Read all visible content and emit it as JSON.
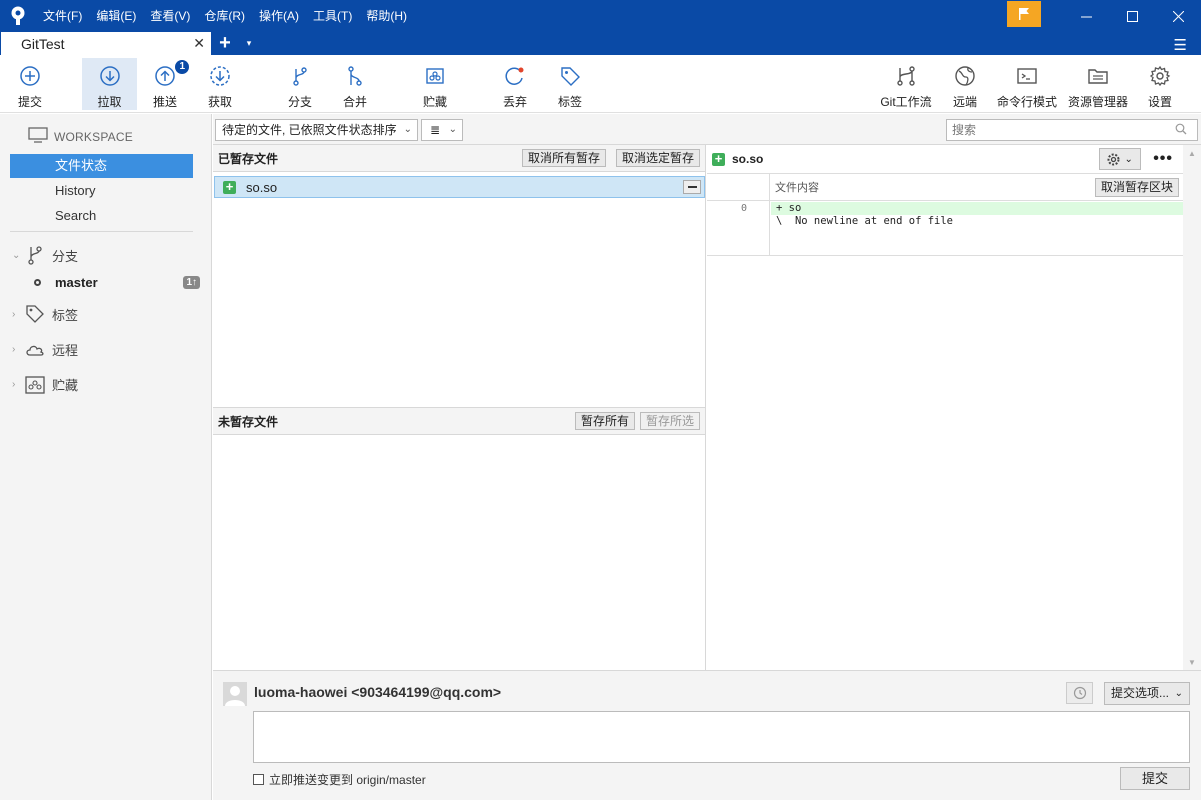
{
  "menu": [
    "文件(F)",
    "编辑(E)",
    "查看(V)",
    "仓库(R)",
    "操作(A)",
    "工具(T)",
    "帮助(H)"
  ],
  "tab": {
    "title": "GitTest",
    "close": "✕",
    "add": "+",
    "dropdown": "▾"
  },
  "toolbar": {
    "commit": "提交",
    "pull": "拉取",
    "push": "推送",
    "push_badge": "1",
    "fetch": "获取",
    "branch": "分支",
    "merge": "合并",
    "stash": "贮藏",
    "discard": "丢弃",
    "tag": "标签",
    "git_flow": "Git工作流",
    "remote": "远端",
    "terminal": "命令行模式",
    "explorer": "资源管理器",
    "settings": "设置"
  },
  "sidebar": {
    "workspace": "WORKSPACE",
    "items": [
      "文件状态",
      "History",
      "Search"
    ],
    "branches": "分支",
    "master": "master",
    "master_count": "1↑",
    "tags": "标签",
    "remotes": "远程",
    "stashes": "贮藏"
  },
  "filter": {
    "sort_label": "待定的文件, 已依照文件状态排序",
    "view_label": "≣",
    "search_placeholder": "搜索"
  },
  "staged": {
    "title": "已暂存文件",
    "unstage_all": "取消所有暂存",
    "unstage_selected": "取消选定暂存",
    "files": [
      "so.so"
    ]
  },
  "unstaged": {
    "title": "未暂存文件",
    "stage_all": "暂存所有",
    "stage_selected": "暂存所选"
  },
  "diff": {
    "file": "so.so",
    "hunk_title": "文件内容",
    "unstage_hunk": "取消暂存区块",
    "line_number": "0",
    "lines": [
      "+ so",
      "\\  No newline at end of file"
    ]
  },
  "commit": {
    "author": "luoma-haowei <903464199@qq.com>",
    "options": "提交选项...",
    "message": "",
    "push_label": "立即推送变更到 origin/master",
    "commit_button": "提交"
  },
  "colors": {
    "titlebar": "#0a4aa6",
    "selection": "#3b8fe0",
    "accent_flag": "#f5a623",
    "add_green": "#3fae5a"
  }
}
